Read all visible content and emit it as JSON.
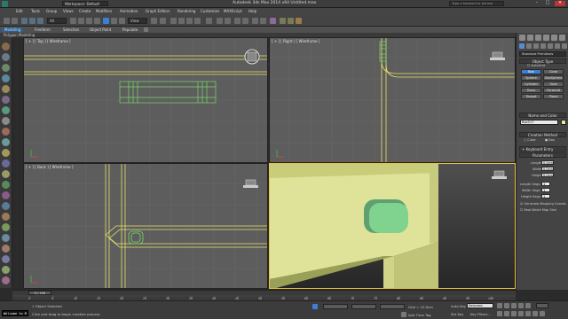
{
  "title_bar": {
    "workspace": "Workspace: Default",
    "file": "Autodesk 3ds Max 2014 x64     Untitled.max",
    "search_placeholder": "Type a keyword or phrase"
  },
  "menu": [
    "Edit",
    "Tools",
    "Group",
    "Views",
    "Create",
    "Modifiers",
    "Animation",
    "Graph Editors",
    "Rendering",
    "Customize",
    "MAXScript",
    "Help"
  ],
  "toolbar": {
    "selection_filter": "All",
    "view_dropdown": "View"
  },
  "ribbon": {
    "tabs": [
      "Modeling",
      "Freeform",
      "Selection",
      "Object Paint",
      "Populate"
    ],
    "subtitle": "Polygon Modeling"
  },
  "viewports": {
    "top": "[ + ] [ Top ] [ Wireframe ]",
    "right": "[ + ] [ Right ] [ Wireframe ]",
    "back": "[ + ] [ Back ] [ Wireframe ]",
    "perspective": ""
  },
  "command_panel": {
    "category_dropdown": "Standard Primitives",
    "object_type_header": "Object Type",
    "autogrid": "AutoGrid",
    "buttons": [
      "Box",
      "Cone",
      "Sphere",
      "GeoSphere",
      "Cylinder",
      "Tube",
      "Torus",
      "Pyramid",
      "Teapot",
      "Plane"
    ],
    "selected_button": "Box",
    "name_color_header": "Name and Color",
    "object_name": "Box017",
    "color_hex": "#f0e7a0",
    "creation_method_header": "Creation Method",
    "creation_cube": "Cube",
    "creation_box": "Box",
    "keyboard_entry": "Keyboard Entry",
    "parameters_header": "Parameters",
    "length_label": "Length:",
    "length_value": "0.0cm",
    "width_label": "Width:",
    "width_value": "0.0cm",
    "height_label": "Height:",
    "height_value": "0.0cm",
    "length_segs_label": "Length Segs:",
    "length_segs": "1",
    "width_segs_label": "Width Segs:",
    "width_segs": "1",
    "height_segs_label": "Height Segs:",
    "height_segs": "1",
    "gen_mapping": "Generate Mapping Coords.",
    "real_world": "Real-World Map Size"
  },
  "timeline": {
    "frame_indicator": "0 / 100",
    "ticks": [
      "0",
      "5",
      "10",
      "15",
      "20",
      "25",
      "30",
      "35",
      "40",
      "45",
      "50",
      "55",
      "60",
      "65",
      "70",
      "75",
      "80",
      "85",
      "90",
      "95",
      "100"
    ]
  },
  "status": {
    "welcome": "Welcome to M",
    "selection": "1 Object Selected",
    "prompt": "Click and drag to begin creation process",
    "grid": "Grid = 10.0cm",
    "auto_key": "Auto Key",
    "selected": "Selected",
    "set_key": "Set Key",
    "key_filters": "Key Filters...",
    "add_time_tag": "Add Time Tag"
  },
  "colors": {
    "wire_yellow": "#e8e26a",
    "wire_green": "#7bd96a",
    "viewport_bg": "#5d5d5d",
    "persp_bg_top": "#4a4a4a",
    "active_border": "#e8c23a",
    "box_face": "#d8e07a",
    "handle_face": "#6ed18a",
    "selected_blue": "#3d7fd4"
  }
}
